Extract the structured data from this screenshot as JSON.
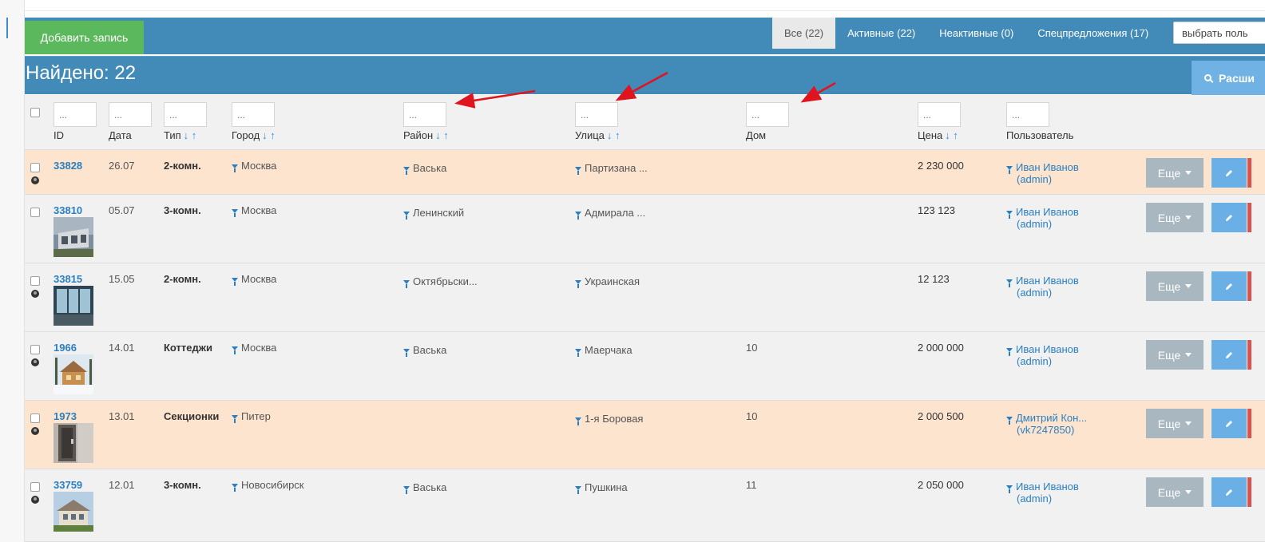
{
  "toolbar": {
    "add_label": "Добавить запись",
    "tabs": [
      {
        "label": "Все (22)",
        "active": true
      },
      {
        "label": "Активные (22)",
        "active": false
      },
      {
        "label": "Неактивные (0)",
        "active": false
      },
      {
        "label": "Спецпредложения (17)",
        "active": false
      }
    ],
    "user_select_value": "выбрать поль"
  },
  "found": {
    "title": "Найдено: 22",
    "ext_search_label": "Расши"
  },
  "filters": {
    "placeholder": "..."
  },
  "columns": {
    "id": "ID",
    "date": "Дата",
    "type": "Тип",
    "city": "Город",
    "district": "Район",
    "street": "Улица",
    "house": "Дом",
    "price": "Цена",
    "user": "Пользователь",
    "sort_arrows": "↓ ↑"
  },
  "rows": [
    {
      "id": "33828",
      "date": "26.07",
      "type": "2-комн.",
      "city": "Москва",
      "district": "Васька",
      "street": "Партизана ...",
      "house": "",
      "price": "2 230 000",
      "user": "Иван Иванов",
      "user_login": "(admin)",
      "globe": true,
      "thumb": false,
      "highlight": true
    },
    {
      "id": "33810",
      "date": "05.07",
      "type": "3-комн.",
      "city": "Москва",
      "district": "Ленинский",
      "street": "Адмирала ...",
      "house": "",
      "price": "123 123",
      "user": "Иван Иванов",
      "user_login": "(admin)",
      "globe": false,
      "thumb": true,
      "highlight": false
    },
    {
      "id": "33815",
      "date": "15.05",
      "type": "2-комн.",
      "city": "Москва",
      "district": "Октябрьски...",
      "street": "Украинская",
      "house": "",
      "price": "12 123",
      "user": "Иван Иванов",
      "user_login": "(admin)",
      "globe": true,
      "thumb": true,
      "highlight": false
    },
    {
      "id": "1966",
      "date": "14.01",
      "type": "Коттеджи",
      "city": "Москва",
      "district": "Васька",
      "street": "Маерчака",
      "house": "10",
      "price": "2 000 000",
      "user": "Иван Иванов",
      "user_login": "(admin)",
      "globe": true,
      "thumb": true,
      "highlight": false
    },
    {
      "id": "1973",
      "date": "13.01",
      "type": "Секционки",
      "city": "Питер",
      "district": "",
      "street": "1-я Боровая",
      "house": "10",
      "price": "2 000 500",
      "user": "Дмитрий Кон...",
      "user_login": "(vk7247850)",
      "globe": true,
      "thumb": true,
      "highlight": true
    },
    {
      "id": "33759",
      "date": "12.01",
      "type": "3-комн.",
      "city": "Новосибирск",
      "district": "Васька",
      "street": "Пушкина",
      "house": "11",
      "price": "2 050 000",
      "user": "Иван Иванов",
      "user_login": "(admin)",
      "globe": true,
      "thumb": true,
      "highlight": false
    }
  ],
  "row_actions": {
    "more_label": "Еще"
  },
  "colors": {
    "header_blue": "#428bb9",
    "add_green": "#5cb85c",
    "highlight_row": "#fde4ce",
    "link_blue": "#2a7fc1",
    "annotation_red": "#e0141e"
  },
  "icons": [
    "filter-icon",
    "globe-icon",
    "pencil-icon",
    "caret-down-icon",
    "search-icon"
  ]
}
